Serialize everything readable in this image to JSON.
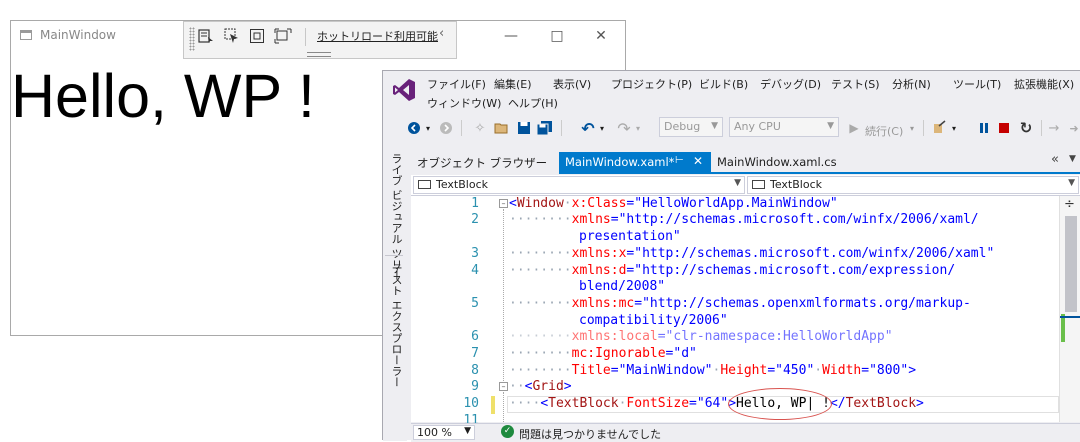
{
  "wpf": {
    "title": "MainWindow",
    "content": "Hello, WP !"
  },
  "runtime_toolbar": {
    "hot_reload": "ホットリロード利用可能"
  },
  "vs": {
    "menu_row1": [
      "ファイル(F)",
      "編集(E)",
      "表示(V)",
      "プロジェクト(P)",
      "ビルド(B)",
      "デバッグ(D)",
      "テスト(S)",
      "分析(N)",
      "ツール(T)",
      "拡張機能(X)"
    ],
    "menu_row2": [
      "ウィンドウ(W)",
      "ヘルプ(H)"
    ],
    "toolbar": {
      "config": "Debug",
      "platform": "Any CPU",
      "continue": "続行(C)"
    },
    "side_tabs": [
      "ライブ ビジュアル ツリー",
      "テスト エクスプローラー"
    ],
    "tabs": {
      "object_browser": "オブジェクト ブラウザー",
      "active": "MainWindow.xaml*",
      "cs": "MainWindow.xaml.cs"
    },
    "nav": {
      "left": "TextBlock",
      "right": "TextBlock"
    },
    "line_numbers": [
      "1",
      "2",
      "3",
      "4",
      "5",
      "6",
      "7",
      "8",
      "9",
      "10",
      "11"
    ],
    "code": {
      "l1_tag": "Window",
      "l1_attr": "x:Class",
      "l1_val": "\"HelloWorldApp.MainWindow\"",
      "l2_attr": "xmlns",
      "l2_val": "\"http://schemas.microsoft.com/winfx/2006/xaml/",
      "l2b_val": "presentation\"",
      "l3_attr": "xmlns:x",
      "l3_val": "\"http://schemas.microsoft.com/winfx/2006/xaml\"",
      "l4_attr": "xmlns:d",
      "l4_val": "\"http://schemas.microsoft.com/expression/",
      "l4b_val": "blend/2008\"",
      "l5_attr": "xmlns:mc",
      "l5_val": "\"http://schemas.openxmlformats.org/markup-",
      "l5b_val": "compatibility/2006\"",
      "l6_attr": "xmlns:local",
      "l6_val": "\"clr-namespace:HelloWorldApp\"",
      "l7_attr": "mc:Ignorable",
      "l7_val": "\"d\"",
      "l8_attr1": "Title",
      "l8_val1": "\"MainWindow\"",
      "l8_attr2": "Height",
      "l8_val2": "\"450\"",
      "l8_attr3": "Width",
      "l8_val3": "\"800\"",
      "l9_tag": "Grid",
      "l10_tag": "TextBlock",
      "l10_attr": "FontSize",
      "l10_val": "\"64\"",
      "l10_text": "Hello, WP| !",
      "l10_close": "TextBlock"
    },
    "status": {
      "zoom": "100 %",
      "issues": "問題は見つかりませんでした"
    }
  },
  "colors": {
    "accent": "#007acc",
    "vs_purple": "#68217a",
    "annotation": "#d9534f"
  }
}
